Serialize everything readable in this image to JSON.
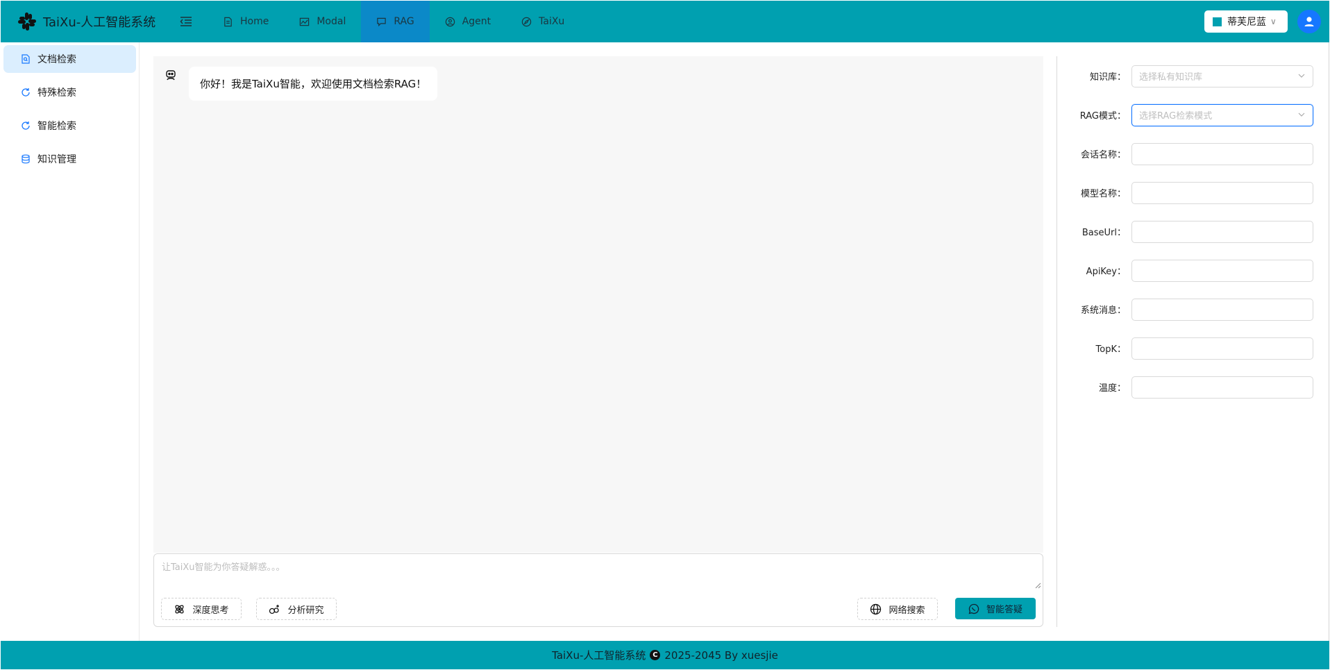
{
  "header": {
    "title": "TaiXu-人工智能系统",
    "nav": [
      {
        "label": "Home",
        "icon": "document-icon",
        "active": false
      },
      {
        "label": "Modal",
        "icon": "image-chart-icon",
        "active": false
      },
      {
        "label": "RAG",
        "icon": "chat-icon",
        "active": true
      },
      {
        "label": "Agent",
        "icon": "user-circle-icon",
        "active": false
      },
      {
        "label": "TaiXu",
        "icon": "compass-icon",
        "active": false
      }
    ],
    "theme": {
      "label": "蒂芙尼蓝",
      "color": "#00a0b0"
    }
  },
  "sidebar": {
    "items": [
      {
        "label": "文档检索",
        "icon": "file-search-icon",
        "active": true
      },
      {
        "label": "特殊检索",
        "icon": "refresh-icon",
        "active": false
      },
      {
        "label": "智能检索",
        "icon": "refresh-icon",
        "active": false
      },
      {
        "label": "知识管理",
        "icon": "database-icon",
        "active": false
      }
    ]
  },
  "chat": {
    "greeting": "你好！我是TaiXu智能，欢迎使用文档检索RAG！",
    "input_placeholder": "让TaiXu智能为你答疑解惑。。。",
    "buttons": {
      "deep_think": "深度思考",
      "analysis": "分析研究",
      "web_search": "网络搜索",
      "send": "智能答疑"
    }
  },
  "form": {
    "knowledge_base": {
      "label": "知识库：",
      "placeholder": "选择私有知识库"
    },
    "rag_mode": {
      "label": "RAG模式：",
      "placeholder": "选择RAG检索模式"
    },
    "session_name": {
      "label": "会话名称：",
      "value": ""
    },
    "model_name": {
      "label": "模型名称：",
      "value": ""
    },
    "base_url": {
      "label": "BaseUrl：",
      "value": ""
    },
    "api_key": {
      "label": "ApiKey：",
      "value": ""
    },
    "system_message": {
      "label": "系统消息：",
      "value": ""
    },
    "topk": {
      "label": "TopK：",
      "value": ""
    },
    "temperature": {
      "label": "温度：",
      "value": ""
    }
  },
  "footer": {
    "prefix": "TaiXu-人工智能系统",
    "suffix": "2025-2045 By xuesjie"
  },
  "colors": {
    "accent": "#00a0b0",
    "active_nav": "#0b89c8",
    "primary": "#1677ff"
  }
}
